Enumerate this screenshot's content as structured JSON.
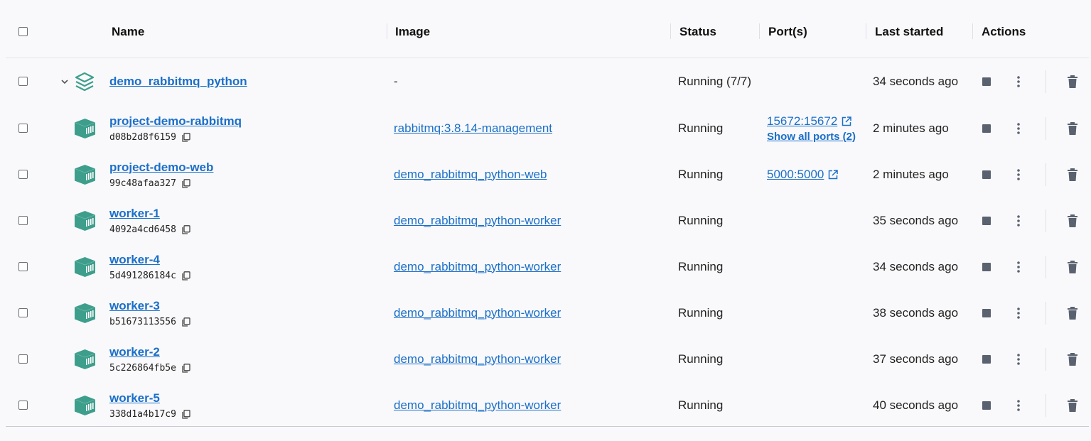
{
  "header": {
    "name": "Name",
    "image": "Image",
    "status": "Status",
    "ports": "Port(s)",
    "last_started": "Last started",
    "actions": "Actions"
  },
  "group": {
    "name": "demo_rabbitmq_python",
    "image": "-",
    "status": "Running (7/7)",
    "last_started": "34 seconds ago"
  },
  "containers": [
    {
      "name": "project-demo-rabbitmq",
      "id": "d08b2d8f6159",
      "image": "rabbitmq:3.8.14-management",
      "status": "Running",
      "port": "15672:15672",
      "show_ports": "Show all ports (2)",
      "last_started": "2 minutes ago"
    },
    {
      "name": "project-demo-web",
      "id": "99c48afaa327",
      "image": "demo_rabbitmq_python-web",
      "status": "Running",
      "port": "5000:5000",
      "last_started": "2 minutes ago"
    },
    {
      "name": "worker-1",
      "id": "4092a4cd6458",
      "image": "demo_rabbitmq_python-worker",
      "status": "Running",
      "last_started": "35 seconds ago"
    },
    {
      "name": "worker-4",
      "id": "5d491286184c",
      "image": "demo_rabbitmq_python-worker",
      "status": "Running",
      "last_started": "34 seconds ago"
    },
    {
      "name": "worker-3",
      "id": "b51673113556",
      "image": "demo_rabbitmq_python-worker",
      "status": "Running",
      "last_started": "38 seconds ago"
    },
    {
      "name": "worker-2",
      "id": "5c226864fb5e",
      "image": "demo_rabbitmq_python-worker",
      "status": "Running",
      "last_started": "37 seconds ago"
    },
    {
      "name": "worker-5",
      "id": "338d1a4b17c9",
      "image": "demo_rabbitmq_python-worker",
      "status": "Running",
      "last_started": "40 seconds ago"
    }
  ],
  "icons": {
    "container": "container-icon",
    "stack": "stack-icon",
    "copy": "copy-icon",
    "external": "external-link-icon",
    "stop": "stop-icon",
    "more": "more-vertical-icon",
    "trash": "trash-icon",
    "chevron": "chevron-down-icon"
  },
  "colors": {
    "link": "#1b6fc8",
    "container_icon": "#3d9e8c",
    "action_icon": "#5a6270"
  }
}
